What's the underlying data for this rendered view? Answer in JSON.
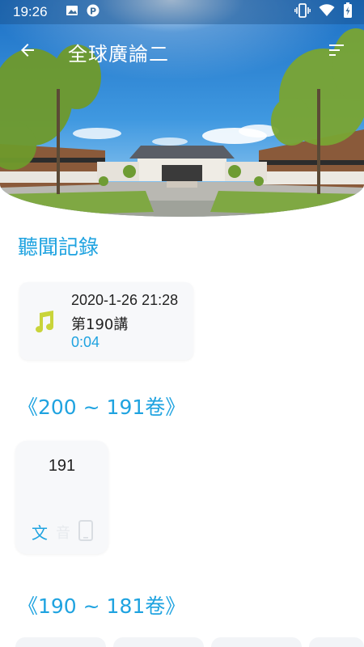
{
  "status_bar": {
    "time": "19:26",
    "icons": [
      "image-icon",
      "p-icon",
      "vibrate-icon",
      "wifi-icon",
      "battery-icon"
    ]
  },
  "app_bar": {
    "title": "全球廣論二",
    "back_icon": "arrow-left-icon",
    "menu_icon": "sort-menu-icon"
  },
  "history": {
    "heading": "聽聞記錄",
    "item": {
      "datetime": "2020-1-26 21:28",
      "lecture": "第190講",
      "position": "0:04",
      "icon": "music-note-icon"
    }
  },
  "groups": [
    {
      "heading": "《200 ~ 191卷》",
      "volumes": [
        {
          "number": "191",
          "text_label": "文",
          "audio_label": "音",
          "device_icon": "phone-icon"
        }
      ]
    },
    {
      "heading": "《190 ~ 181卷》"
    }
  ],
  "colors": {
    "accent": "#1fa3e0",
    "note_icon": "#c9d43a",
    "card_bg": "#f7f8fa"
  }
}
